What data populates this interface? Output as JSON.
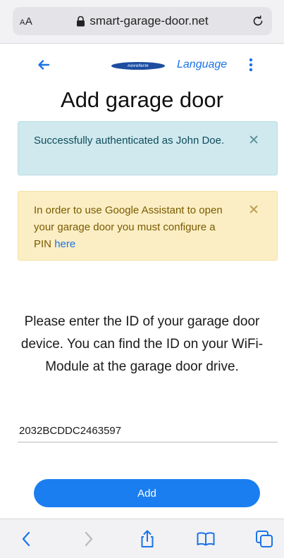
{
  "browser": {
    "text_size_label_small": "A",
    "text_size_label_large": "A",
    "url": "smart-garage-door.net"
  },
  "header": {
    "logo_text": "novoferm",
    "language_label": "Language"
  },
  "page": {
    "title": "Add garage door"
  },
  "alerts": {
    "success": {
      "text": "Successfully authenticated as John Doe.",
      "close": "✕"
    },
    "warning": {
      "text": "In order to use Google Assistant to open your garage door you must configure a PIN ",
      "link": "here",
      "close": "✕"
    }
  },
  "instructions": "Please enter the ID of your garage door device. You can find the ID on your WiFi-Module at the garage door drive.",
  "device_id": {
    "value": "2032BCDDC2463597"
  },
  "add_button_label": "Add",
  "colors": {
    "accent": "#1a7ef0",
    "link": "#1a73e8",
    "success_bg": "#cfe9ee",
    "warning_bg": "#fbeec4"
  },
  "icons": {
    "toolbar": [
      "back-icon",
      "forward-icon",
      "share-icon",
      "bookmarks-icon",
      "tabs-icon"
    ]
  }
}
